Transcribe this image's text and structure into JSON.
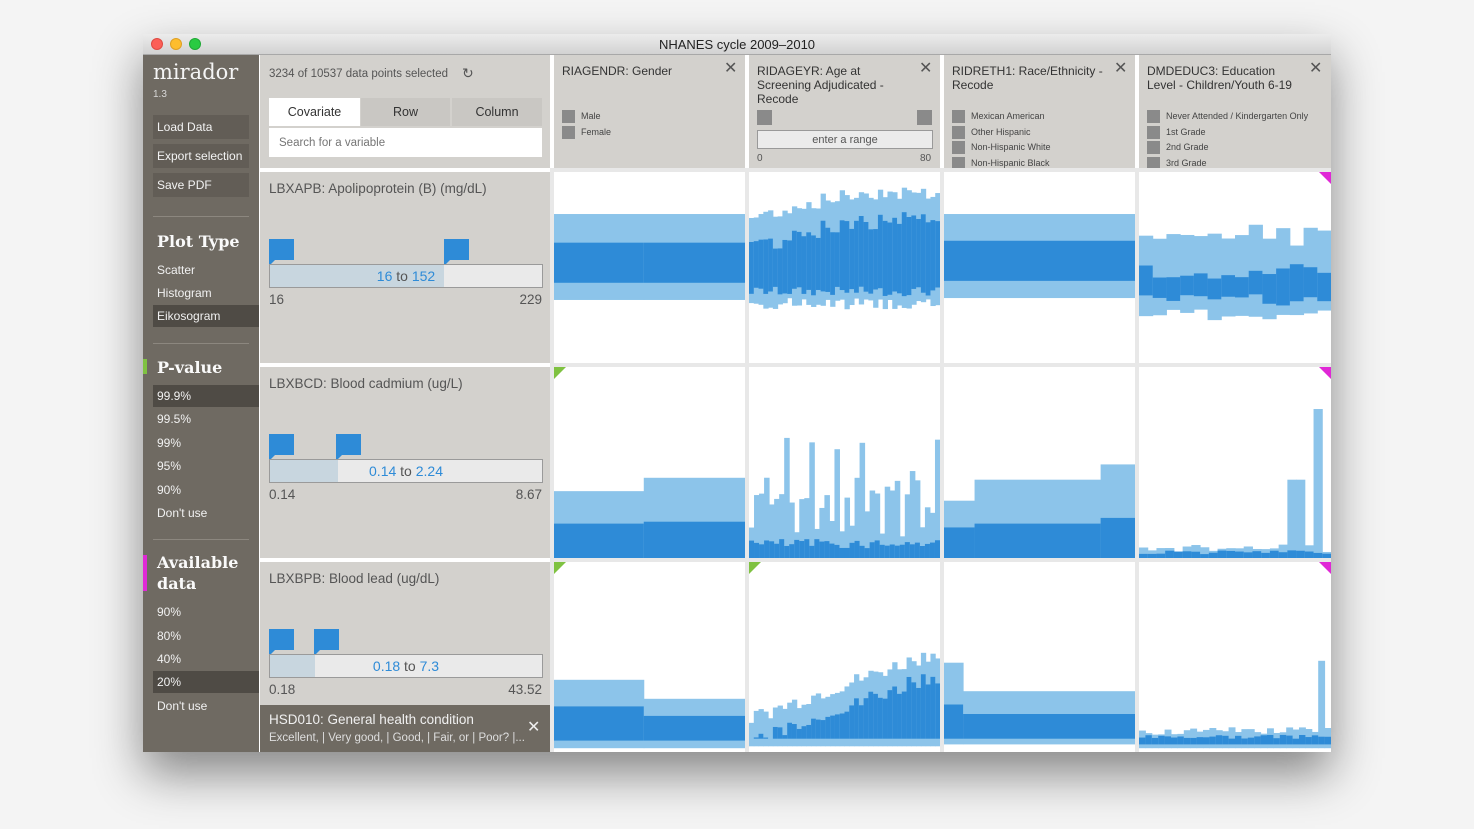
{
  "window": {
    "title": "NHANES cycle 2009–2010"
  },
  "app": {
    "name": "mirador",
    "version": "1.3"
  },
  "sidebar": {
    "actions": [
      "Load Data",
      "Export selection",
      "Save PDF"
    ],
    "plot_type": {
      "title": "Plot Type",
      "options": [
        "Scatter",
        "Histogram",
        "Eikosogram"
      ],
      "selected": 2
    },
    "pvalue": {
      "title": "P-value",
      "options": [
        "99.9%",
        "99.5%",
        "99%",
        "95%",
        "90%",
        "Don't use"
      ],
      "selected": 0,
      "marker_color": "#7fc241"
    },
    "available": {
      "title_line1": "Available",
      "title_line2": "data",
      "options": [
        "90%",
        "80%",
        "40%",
        "20%",
        "Don't use"
      ],
      "selected": 3,
      "marker_color": "#e028d6"
    }
  },
  "controls": {
    "selection_count": "3234 of 10537 data points selected",
    "tabs": [
      "Covariate",
      "Row",
      "Column"
    ],
    "active_tab": 0,
    "search_placeholder": "Search for a variable"
  },
  "columns": [
    {
      "title": "RIAGENDR: Gender",
      "legend": [
        "Male",
        "Female"
      ]
    },
    {
      "title": "RIDAGEYR: Age at Screening Adjudicated - Recode",
      "range_placeholder": "enter a range",
      "min": "0",
      "max": "80"
    },
    {
      "title": "RIDRETH1: Race/Ethnicity - Recode",
      "legend": [
        "Mexican American",
        "Other Hispanic",
        "Non-Hispanic White",
        "Non-Hispanic Black"
      ]
    },
    {
      "title": "DMDEDUC3: Education Level - Children/Youth 6-19",
      "legend": [
        "Never Attended / Kindergarten Only",
        "1st Grade",
        "2nd Grade",
        "3rd Grade"
      ]
    }
  ],
  "rows": [
    {
      "title": "LBXAPB: Apolipoprotein (B) (mg/dL)",
      "low": "16",
      "high": "152",
      "to": "to",
      "min": "16",
      "max": "229",
      "fill": 0.64
    },
    {
      "title": "LBXBCD: Blood cadmium (ug/L)",
      "low": "0.14",
      "high": "2.24",
      "to": "to",
      "min": "0.14",
      "max": "8.67",
      "fill": 0.25
    },
    {
      "title": "LBXBPB: Blood lead (ug/dL)",
      "low": "0.18",
      "high": "7.3",
      "to": "to",
      "min": "0.18",
      "max": "43.52",
      "fill": 0.165
    }
  ],
  "extra_variable": {
    "title": "HSD010: General health condition",
    "subtitle": "Excellent, | Very good, | Good, | Fair, or | Poor? |..."
  },
  "colors": {
    "light": "#8cc4ea",
    "dark": "#2e8bd7",
    "pval_corner": "#7fc241",
    "missing_corner": "#e028d6"
  }
}
